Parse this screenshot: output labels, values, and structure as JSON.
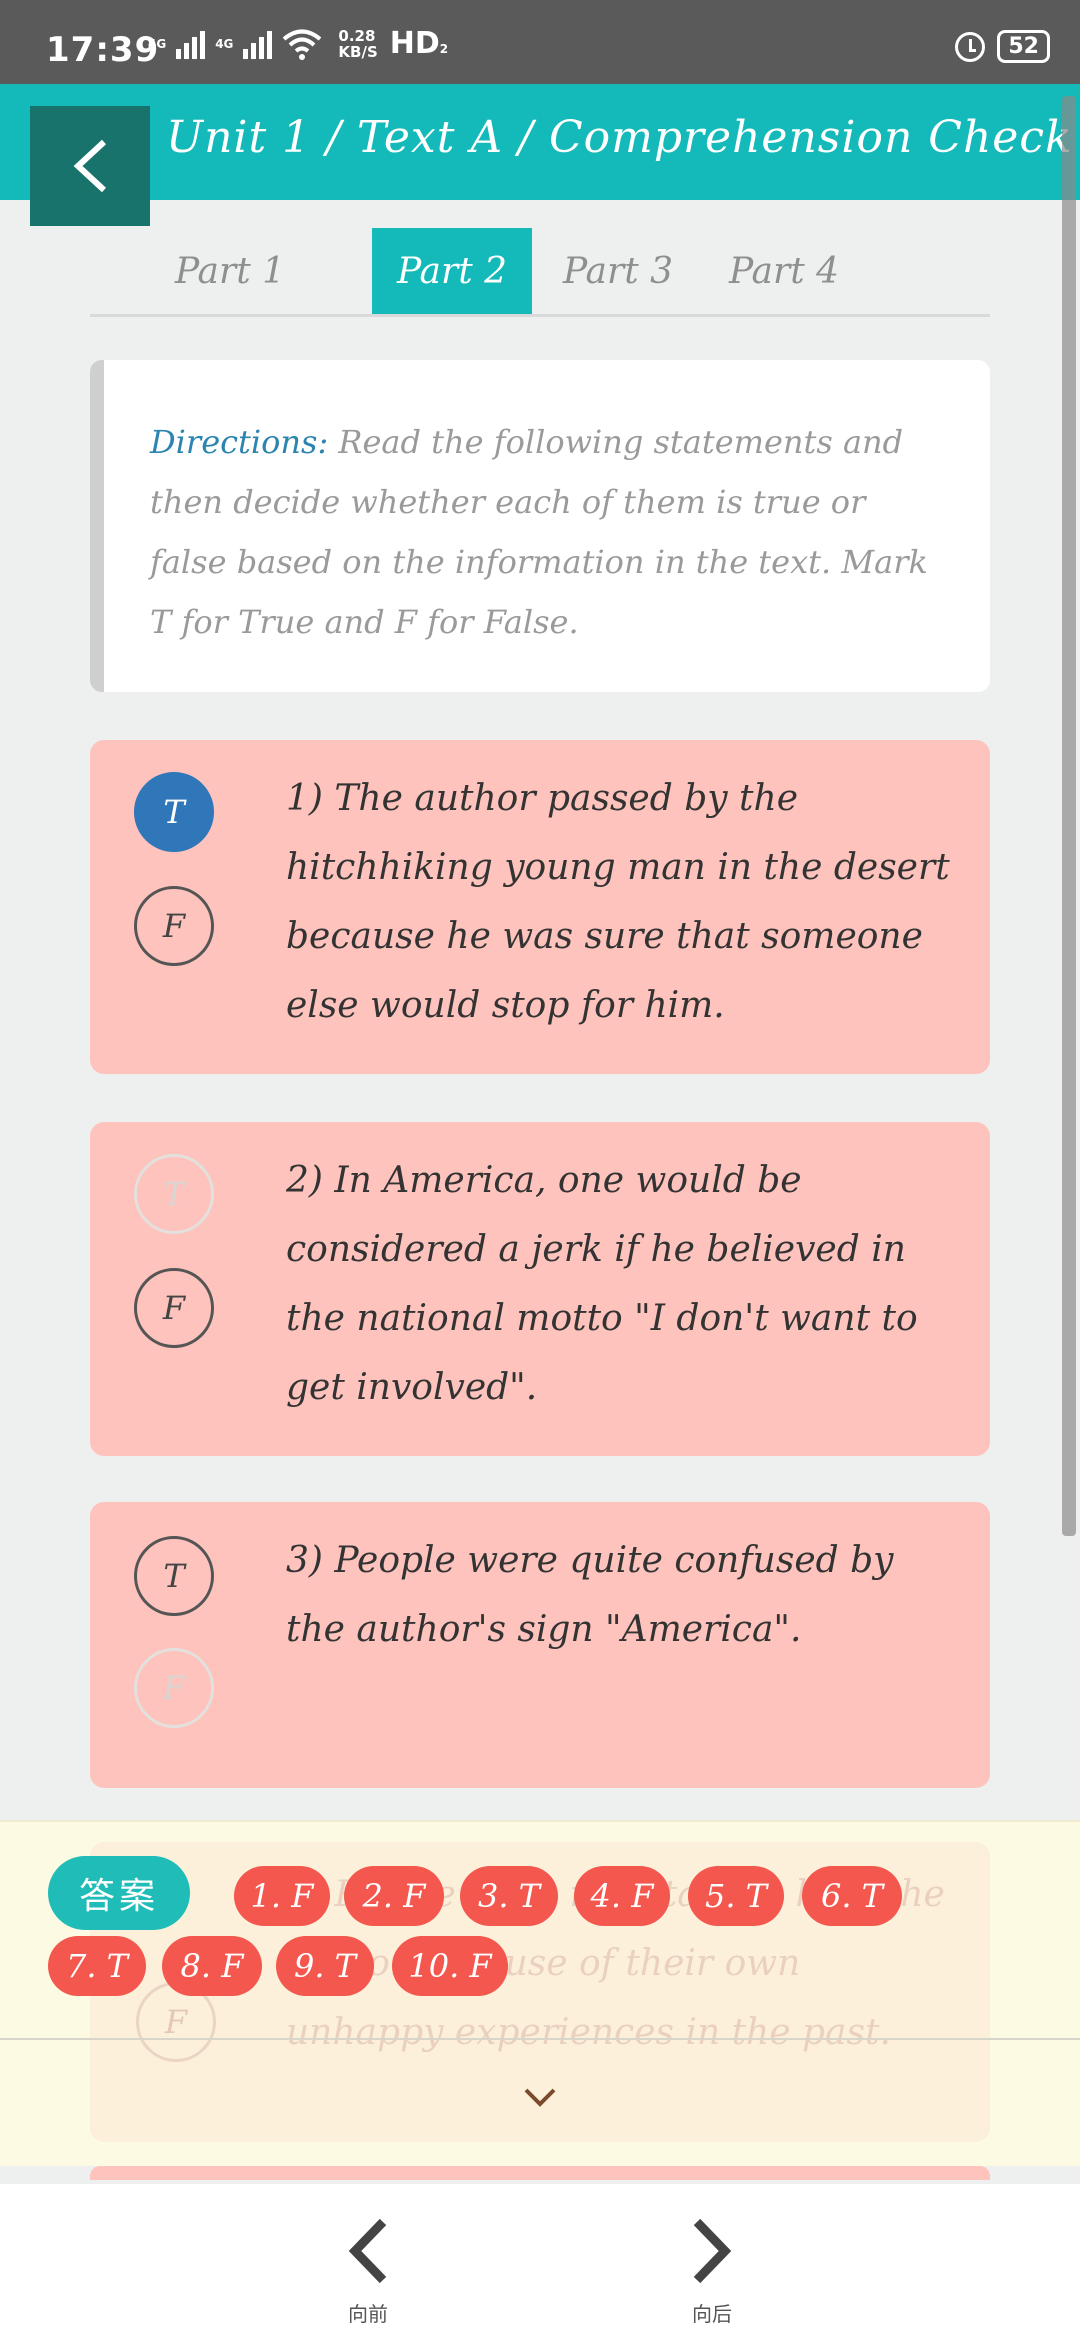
{
  "status_bar": {
    "time": "17:39",
    "network_1": "4G",
    "network_2": "4G",
    "speed_value": "0.28",
    "speed_unit": "KB/S",
    "hd": "HD",
    "hd_sub": "2",
    "battery": "52",
    "icons": [
      "signal-icon",
      "wifi-icon",
      "alarm-icon",
      "battery-icon"
    ]
  },
  "header": {
    "title": "Unit 1 / Text A / Comprehension Check",
    "back_icon": "back-arrow-icon"
  },
  "tabs": [
    {
      "label": "Part 1",
      "active": false
    },
    {
      "label": "Part 2",
      "active": true
    },
    {
      "label": "Part 3",
      "active": false
    },
    {
      "label": "Part 4",
      "active": false
    }
  ],
  "directions": {
    "label": "Directions:",
    "text": "Read the following statements and then decide whether each of them is true or false based on the information in the text. Mark T for True and F for False."
  },
  "questions": [
    {
      "number": "1)",
      "text": "The author passed by the hitchhiking young man in the desert because he was sure that someone else would stop for him.",
      "option_t": "T",
      "option_f": "F",
      "selected": "T"
    },
    {
      "number": "2)",
      "text": "In America, one would be considered a jerk if he believed in the national motto \"I don't want to get involved\".",
      "option_t": "T",
      "option_f": "F",
      "selected": "F"
    },
    {
      "number": "3)",
      "text": "People were quite confused by the author's sign \"America\".",
      "option_t": "T",
      "option_f": "F",
      "selected": "T"
    },
    {
      "number": "4)",
      "text": "People were reluctant to help the author because of their own unhappy experiences in the past.",
      "option_f": "F"
    }
  ],
  "answers": {
    "label": "答案",
    "items": [
      "1. F",
      "2. F",
      "3. T",
      "4. F",
      "5. T",
      "6. T",
      "7. T",
      "8. F",
      "9. T",
      "10. F"
    ],
    "collapse_icon": "chevron-down-icon"
  },
  "bottom_nav": {
    "prev_label": "向前",
    "next_label": "向后"
  },
  "colors": {
    "accent": "#14b9b9",
    "card": "#fec3bc",
    "selected": "#2f77b8",
    "answer_chip": "#f3574d"
  }
}
